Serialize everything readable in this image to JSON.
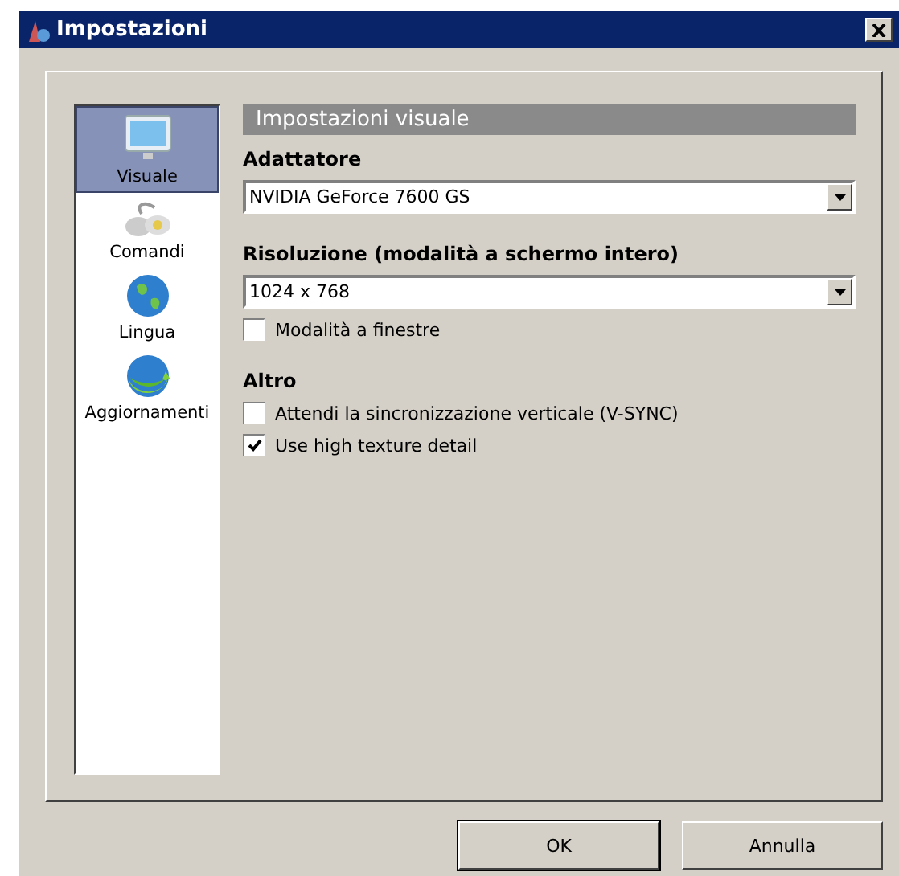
{
  "window": {
    "title": "Impostazioni"
  },
  "sidebar": {
    "items": [
      {
        "label": "Visuale",
        "kind": "display",
        "selected": true
      },
      {
        "label": "Comandi",
        "kind": "gamepad",
        "selected": false
      },
      {
        "label": "Lingua",
        "kind": "globe",
        "selected": false
      },
      {
        "label": "Aggiornamenti",
        "kind": "update",
        "selected": false
      }
    ]
  },
  "panel": {
    "header": "Impostazioni visuale",
    "rows": [
      {
        "kind": "heading",
        "label": "Adattatore"
      },
      {
        "kind": "dropdown",
        "value": "NVIDIA GeForce 7600 GS"
      },
      {
        "kind": "heading",
        "label": "Risoluzione (modalità a schermo intero)"
      },
      {
        "kind": "dropdown",
        "value": "1024 x 768"
      },
      {
        "kind": "checkbox",
        "label": "Modalità a finestre",
        "checked": false
      },
      {
        "kind": "heading",
        "label": "Altro"
      },
      {
        "kind": "checkbox",
        "label": "Attendi la sincronizzazione verticale (V-SYNC)",
        "checked": false
      },
      {
        "kind": "checkbox",
        "label": "Use high texture detail",
        "checked": true
      }
    ]
  },
  "buttons": [
    "OK",
    "Annulla"
  ]
}
